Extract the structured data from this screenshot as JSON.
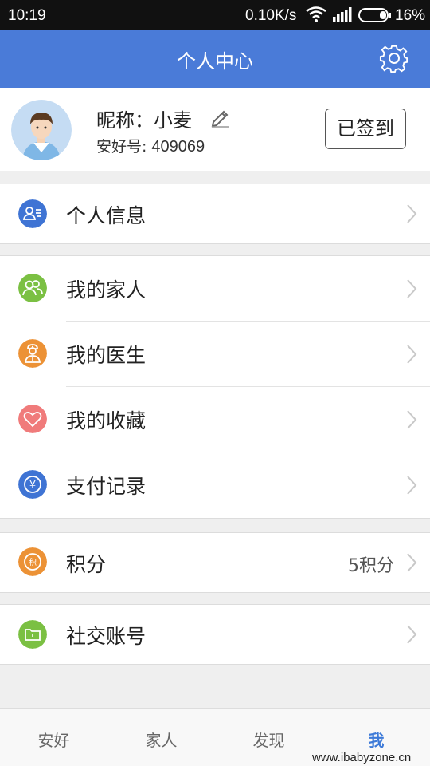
{
  "status_bar": {
    "time": "10:19",
    "speed": "0.10K/s",
    "battery": "16%"
  },
  "header": {
    "title": "个人中心"
  },
  "profile": {
    "nickname": "昵称：小麦",
    "id_label": "安好号:",
    "id_value": "409069",
    "checkin": "已签到"
  },
  "menu": {
    "info": "个人信息",
    "family": "我的家人",
    "doctor": "我的医生",
    "favorites": "我的收藏",
    "payments": "支付记录",
    "points": "积分",
    "points_value": "5积分",
    "social": "社交账号"
  },
  "tabs": [
    "安好",
    "家人",
    "发现",
    "我"
  ],
  "watermark": "www.ibabyzone.cn",
  "colors": {
    "header": "#4a7bd8",
    "blue": "#3f74d4",
    "green": "#7bc043",
    "orange": "#ec9236",
    "pink": "#f07b7b",
    "active_tab": "#3d7ad8"
  }
}
